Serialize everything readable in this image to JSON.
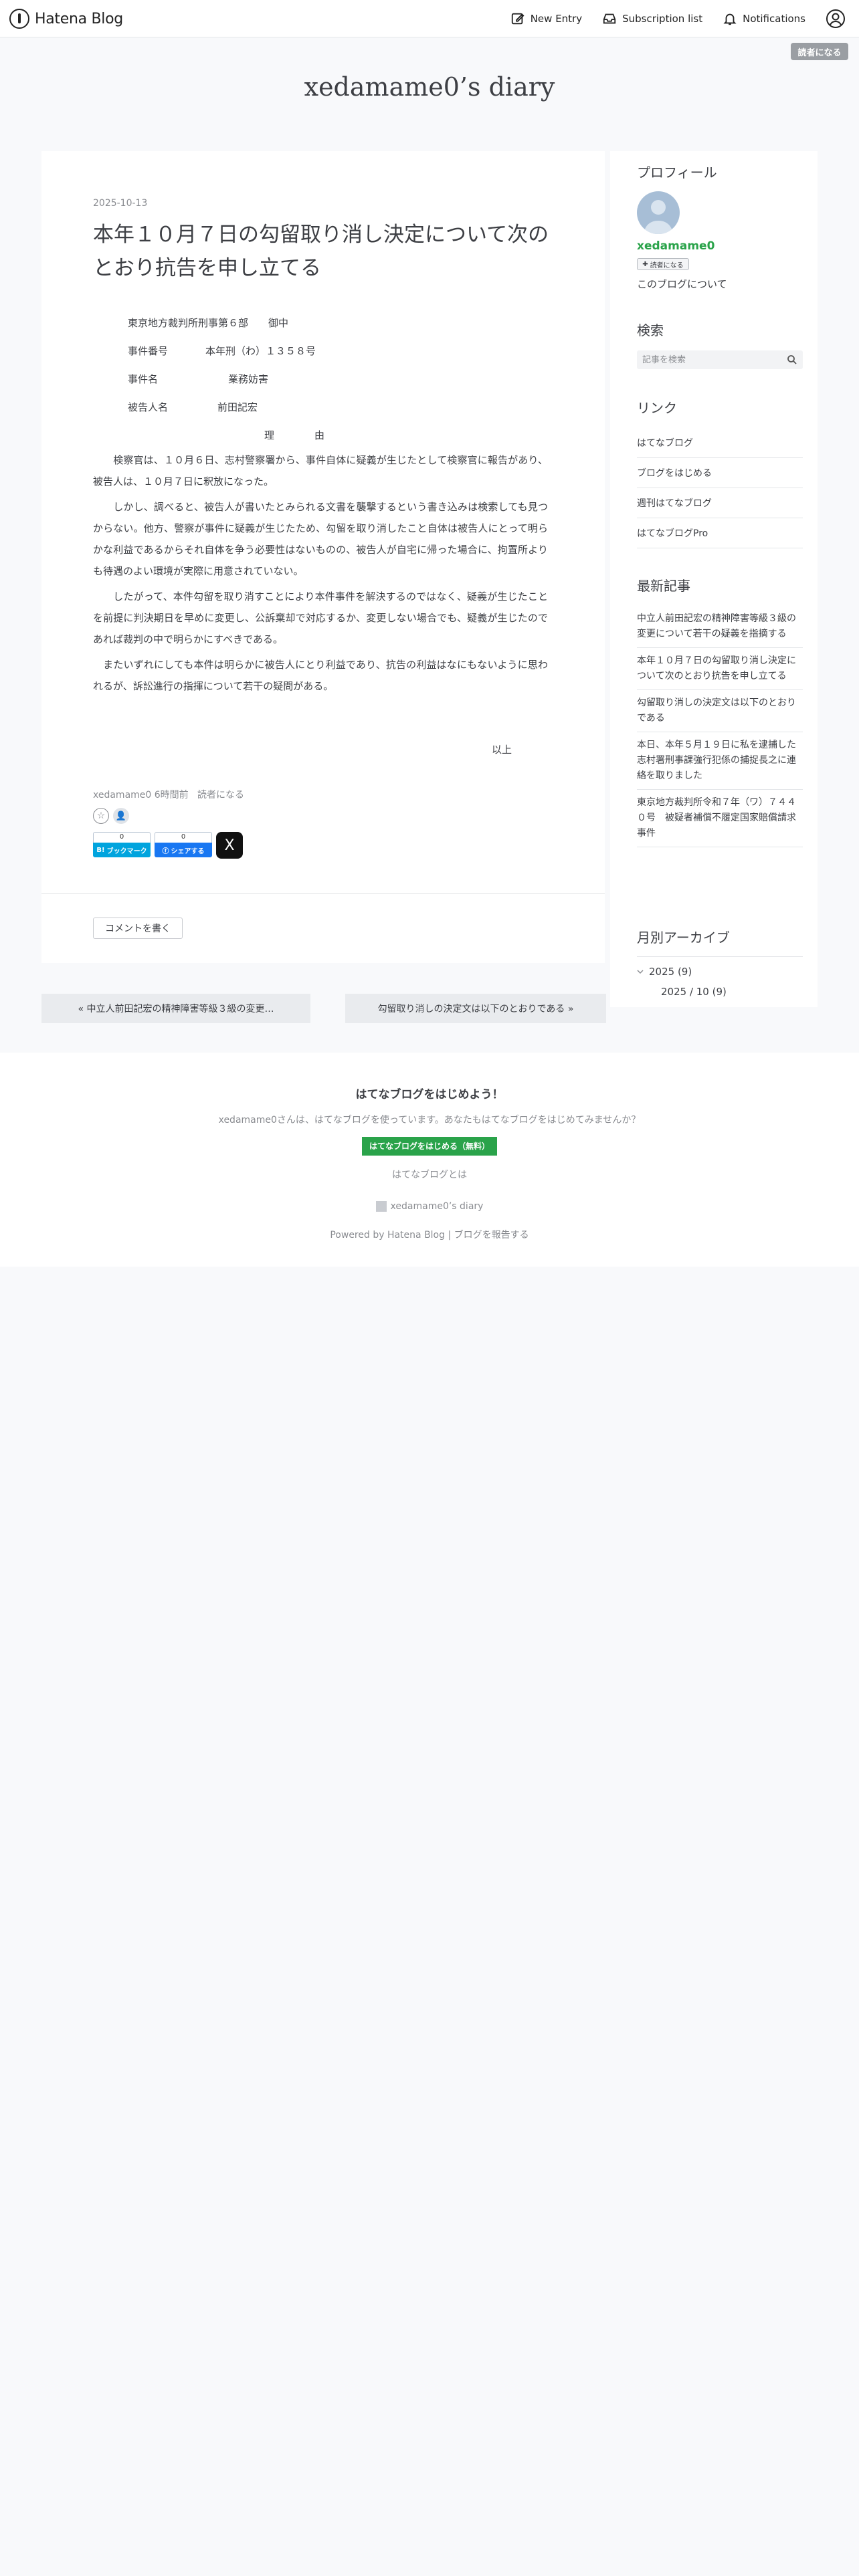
{
  "header": {
    "logo_text": "Hatena Blog",
    "nav": {
      "new_entry": "New Entry",
      "subscription": "Subscription list",
      "notifications": "Notifications"
    }
  },
  "reader_button": "読者になる",
  "blog_title": "xedamame0’s diary",
  "entry": {
    "date": "2025-10-13",
    "title": "本年１０月７日の勾留取り消し決定について次のとおり抗告を申し立てる",
    "body": {
      "court": "東京地方裁判所刑事第６部　　御中",
      "case_no_label": "事件番号",
      "case_no": "本年刑（わ）１３５８号",
      "case_name_label": "事件名",
      "case_name": "業務妨害",
      "defendant_label": "被告人名",
      "defendant": "前田記宏",
      "reason_heading": "理　　　　由",
      "p1": "　　検察官は、１０月６日、志村警察署から、事件自体に疑義が生じたとして検察官に報告があり、被告人は、１０月７日に釈放になった。",
      "p2": "　　しかし、調べると、被告人が書いたとみられる文書を襲撃するという書き込みは検索しても見つからない。他方、警察が事件に疑義が生じたため、勾留を取り消したこと自体は被告人にとって明らかな利益であるからそれ自体を争う必要性はないものの、被告人が自宅に帰った場合に、拘置所よりも待遇のよい環境が実際に用意されていない。",
      "p3": "　　したがって、本件勾留を取り消すことにより本件事件を解決するのではなく、疑義が生じたことを前提に判決期日を早めに変更し、公訴棄却で対応するか、変更しない場合でも、疑義が生じたのであれば裁判の中で明らかにすべきである。",
      "p4": "　またいずれにしても本件は明らかに被告人にとり利益であり、抗告の利益はなにもないように思われるが、訴訟進行の指揮について若干の疑問がある。",
      "closing": "以上"
    },
    "author": "xedamame0",
    "time_ago": "6時間前",
    "reader_link": "読者になる",
    "share": {
      "hatena_count": "0",
      "hatena_label": "ブックマーク",
      "fb_count": "0",
      "fb_label": "シェアする",
      "x_label": "X"
    },
    "comment_button": "コメントを書く"
  },
  "pager": {
    "prev": "« 中立人前田記宏の精神障害等級３級の変更…",
    "next": "勾留取り消しの決定文は以下のとおりである »"
  },
  "sidebar": {
    "profile": {
      "heading": "プロフィール",
      "name": "xedamame0",
      "reader_button": "読者になる",
      "about": "このブログについて"
    },
    "search": {
      "heading": "検索",
      "placeholder": "記事を検索"
    },
    "links": {
      "heading": "リンク",
      "items": [
        "はてなブログ",
        "ブログをはじめる",
        "週刊はてなブログ",
        "はてなブログPro"
      ]
    },
    "recent": {
      "heading": "最新記事",
      "items": [
        "中立人前田記宏の精神障害等級３級の変更について若干の疑義を指摘する",
        "本年１０月７日の勾留取り消し決定について次のとおり抗告を申し立てる",
        "勾留取り消しの決定文は以下のとおりである",
        "本日、本年５月１９日に私を逮捕した志村署刑事課強行犯係の捕捉長之に連絡を取りました",
        "東京地方裁判所令和７年（ワ）７４４０号　被疑者補償不履定国家賠償請求事件"
      ]
    },
    "archive": {
      "heading": "月別アーカイブ",
      "year": "2025 (9)",
      "month": "2025 / 10 (9)"
    }
  },
  "footer": {
    "heading": "はてなブログをはじめよう！",
    "subtext": "xedamame0さんは、はてなブログを使っています。あなたもはてなブログをはじめてみませんか？",
    "start_button": "はてなブログをはじめる（無料）",
    "about": "はてなブログとは",
    "blog_name": "xedamame0’s diary",
    "powered": "Powered by Hatena Blog | ブログを報告する"
  }
}
